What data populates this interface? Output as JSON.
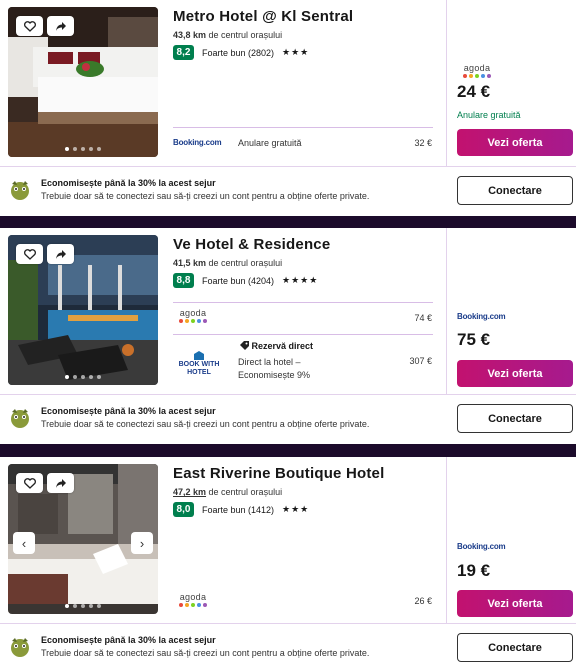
{
  "colors": {
    "accent": "#c2126f",
    "score_green": "#007f4e",
    "divider": "#d8bde6"
  },
  "promo": {
    "title": "Economisește până la 30% la acest sejur",
    "subtitle": "Trebuie doar să te conectezi sau să-ți creezi un cont pentru a obține oferte private.",
    "login_label": "Conectare"
  },
  "offer_button_label": "Vezi oferta",
  "hotels": [
    {
      "name": "Metro Hotel @ Kl Sentral",
      "distance_value": "43,8 km",
      "distance_text": " de centrul orașului",
      "score": "8,2",
      "score_text": "Foarte bun (2802)",
      "stars": "★★★",
      "provider": "agoda",
      "price": "24 €",
      "price_note": "Anulare gratuită",
      "offers": [
        {
          "provider": "Booking.com",
          "note": "Anulare gratuită",
          "price": "32 €"
        }
      ]
    },
    {
      "name": "Ve Hotel & Residence",
      "distance_value": "41,5 km",
      "distance_text": " de centrul orașului",
      "score": "8,8",
      "score_text": "Foarte bun (4204)",
      "stars": "★★★★",
      "provider": "Booking.com",
      "price": "75 €",
      "offers": [
        {
          "provider": "agoda",
          "price": "74 €"
        },
        {
          "provider": "BOOK WITH HOTEL",
          "tag": "Rezervă direct",
          "note": "Direct la hotel – Economisește 9%",
          "price": "307 €"
        }
      ]
    },
    {
      "name": "East Riverine Boutique Hotel",
      "distance_value": "47,2 km",
      "distance_text": " de centrul orașului",
      "score": "8,0",
      "score_text": "Foarte bun (1412)",
      "stars": "★★★",
      "provider": "Booking.com",
      "price": "19 €",
      "offers": [
        {
          "provider": "agoda",
          "price": "26 €"
        }
      ]
    }
  ]
}
